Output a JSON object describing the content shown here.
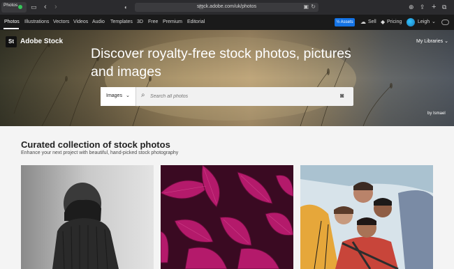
{
  "browser": {
    "tab_label": "Photos",
    "url": "stock.adobe.com/uk/photos"
  },
  "nav": {
    "items": [
      "Photos",
      "Illustrations",
      "Vectors",
      "Videos",
      "Audio",
      "Templates",
      "3D",
      "Free",
      "Premium",
      "Editorial"
    ],
    "assets_label": "½ Assets",
    "sell_label": "Sell",
    "pricing_label": "Pricing",
    "user_name": "Leigh"
  },
  "hero": {
    "logo_text": "St",
    "brand": "Adobe Stock",
    "my_libraries": "My Libraries ⌄",
    "title": "Discover royalty-free stock photos, pictures and images",
    "search_type": "Images",
    "search_placeholder": "Search all photos",
    "credit": "by Ismael"
  },
  "section": {
    "title": "Curated collection of stock photos",
    "subtitle": "Enhance your next project with beautiful, hand-picked stock photography"
  },
  "colors": {
    "accent": "#1473e6",
    "nav_bg": "#1a1a1a",
    "leaf_magenta": "#b41a6b"
  },
  "icons": {
    "sidebar": "sidebar-icon",
    "back": "chevron-left-icon",
    "forward": "chevron-right-icon",
    "shield": "shield-icon",
    "download": "download-icon",
    "share": "share-icon",
    "new_tab": "plus-icon",
    "tabs": "tabs-icon",
    "search": "search-icon",
    "camera": "camera-icon"
  }
}
